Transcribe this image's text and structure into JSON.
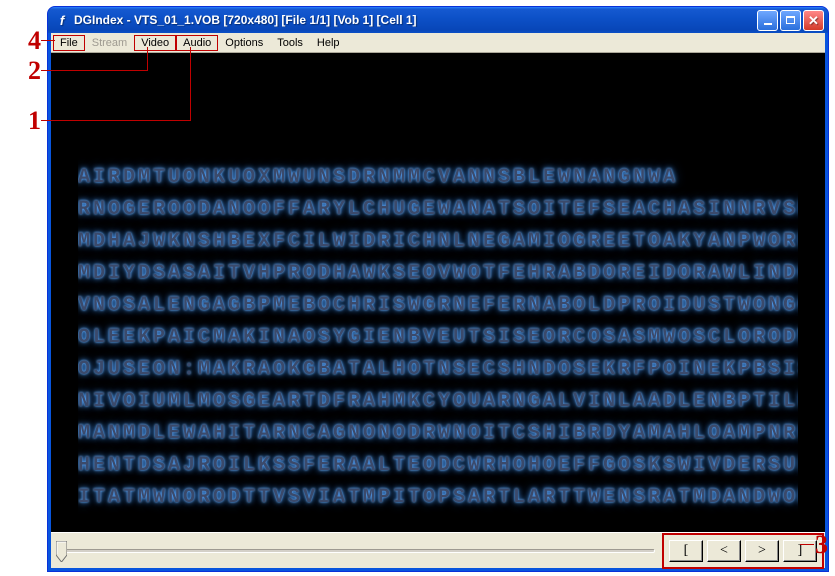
{
  "annotations": {
    "n1": "1",
    "n2": "2",
    "n3": "3",
    "n4": "4"
  },
  "window": {
    "title": "DGIndex - VTS_01_1.VOB [720x480] [File 1/1] [Vob 1] [Cell 1]",
    "icon_letter": "f"
  },
  "menu": {
    "file": "File",
    "stream": "Stream",
    "video": "Video",
    "audio": "Audio",
    "options": "Options",
    "tools": "Tools",
    "help": "Help"
  },
  "nav": {
    "mark_in": "[",
    "step_back": "<",
    "step_fwd": ">",
    "mark_out": "]"
  },
  "video_lines": [
    "AIRDMTUONKUOXMWUNSDRNMMCVANNSBLEWNANGNWA",
    "RNOGEROODANOOFFARYLCHUGEWANATSOITEFSEACHASINNRVSRDIY",
    "MDHAJWKNSHBEXFCILWIDRICHNLNEGAMIOGREETOAKYANPWORD",
    "MDIYDSASAITVHPRODHAWKSEOVWOTFEHRABDOREIDORAWLINDOAN",
    "VNOSALENGAGBPMEBOCHRISWGRNEFERNABOLDPROIDUSTWONGOAN",
    "OLEEKPAICMAKINAOSYGIENBVEUTSISEORCOSASMWOSCLORODWLISHKGE",
    "OJUSEON:MAKRAOKGBATALHOTNSECSHNDOSEKRFPOINEKPBSISCHWKG",
    "NIVOIUMLMOSGEARTDFRAHMKCYOUARNGALVINLAADLENBPTILBEMCSKUHRCAK",
    "MANMDLEWAHITARNCAGNONODRWNOITCSHIBRDYAMAHLOAMPNRKSBEOES&SVOPMBERAGA",
    "HENTDSAJROILKSSFERAALTEODCWRHOHOEFFGOSKSWIVDERSULAWMARDUNDUSOKI",
    "ITATMWNORODTTVSVIATMPITOPSARTLARTTWENSRATMDANDWOHTTARD"
  ]
}
